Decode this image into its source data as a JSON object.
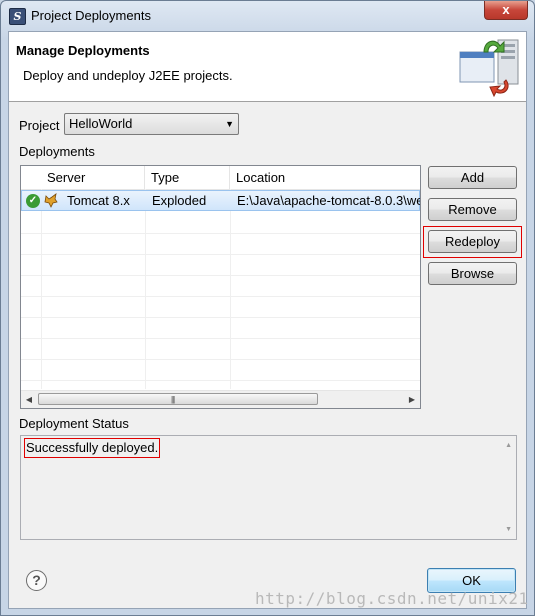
{
  "window": {
    "title": "Project Deployments",
    "close_glyph": "x"
  },
  "banner": {
    "title": "Manage Deployments",
    "description": "Deploy and undeploy J2EE projects."
  },
  "project": {
    "label": "Project",
    "selected": "HelloWorld"
  },
  "deployments": {
    "label": "Deployments",
    "columns": [
      "Server",
      "Type",
      "Location"
    ],
    "rows": [
      {
        "server": "Tomcat  8.x",
        "type": "Exploded",
        "location": "E:\\Java\\apache-tomcat-8.0.3\\we",
        "status_icon": "check-icon",
        "server_icon": "tomcat-icon"
      }
    ]
  },
  "buttons": {
    "add": "Add",
    "remove": "Remove",
    "redeploy": "Redeploy",
    "browse": "Browse",
    "ok": "OK"
  },
  "status": {
    "label": "Deployment Status",
    "text": "Successfully deployed."
  },
  "help_glyph": "?",
  "watermark": "http://blog.csdn.net/unix21",
  "colors": {
    "highlight": "#e00000",
    "selection": "#d0e5fb",
    "ok_border": "#3c7fb1"
  }
}
